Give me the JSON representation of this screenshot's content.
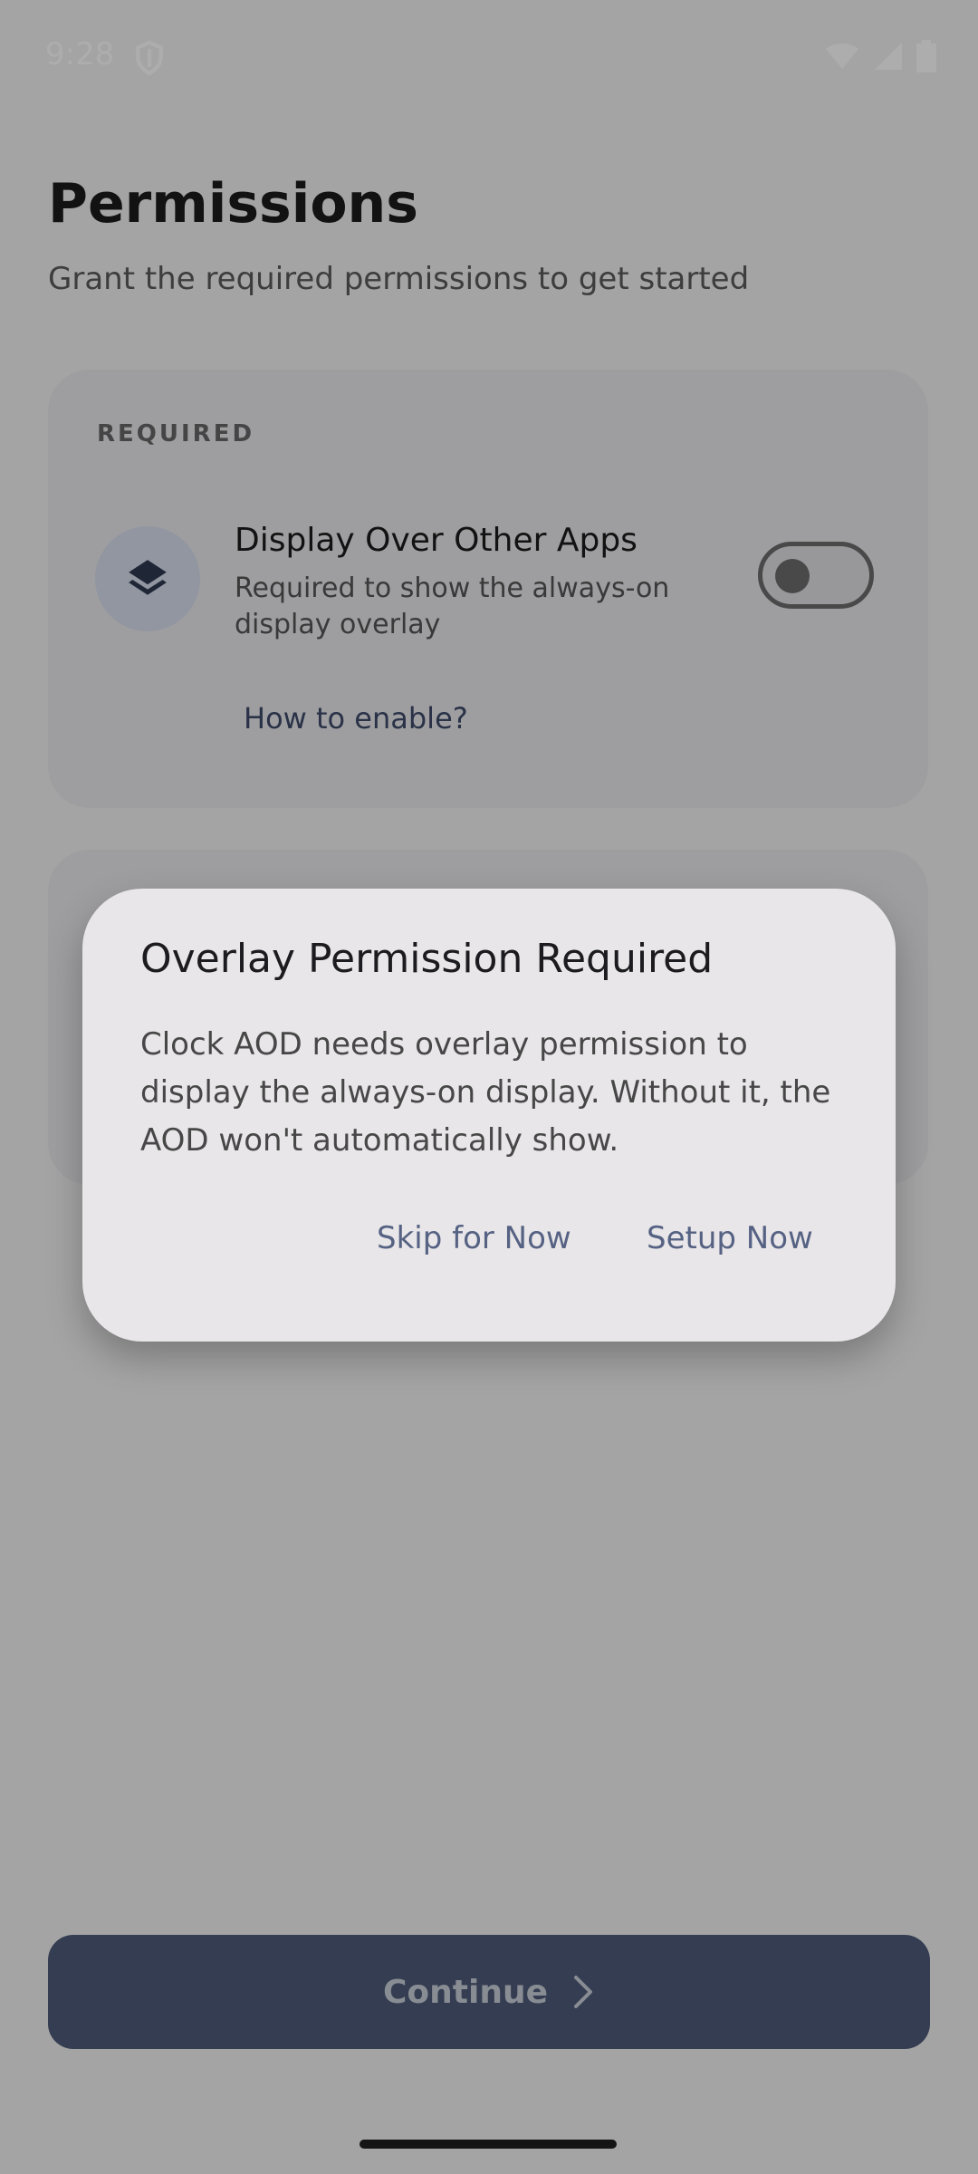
{
  "status_bar": {
    "time": "9:28",
    "icons": [
      "shield-icon",
      "wifi-icon",
      "signal-icon",
      "battery-icon"
    ]
  },
  "page": {
    "title": "Permissions",
    "subtitle": "Grant the required permissions to get started"
  },
  "required_section": {
    "label": "REQUIRED",
    "permission": {
      "icon": "layers-icon",
      "title": "Display Over Other Apps",
      "description": "Required to show the always-on display overlay",
      "enabled": false,
      "help_link": "How to enable?"
    }
  },
  "footer": {
    "continue_label": "Continue",
    "continue_icon": "chevron-right-icon"
  },
  "dialog": {
    "title": "Overlay Permission Required",
    "body": "Clock AOD needs overlay permission to display the always-on display. Without it, the AOD won't automatically show.",
    "skip_label": "Skip for Now",
    "setup_label": "Setup Now"
  },
  "colors": {
    "accent": "#4d5b78",
    "link": "#566283",
    "icon_bg": "#d7deed",
    "card_bg": "#e9e9ec"
  }
}
